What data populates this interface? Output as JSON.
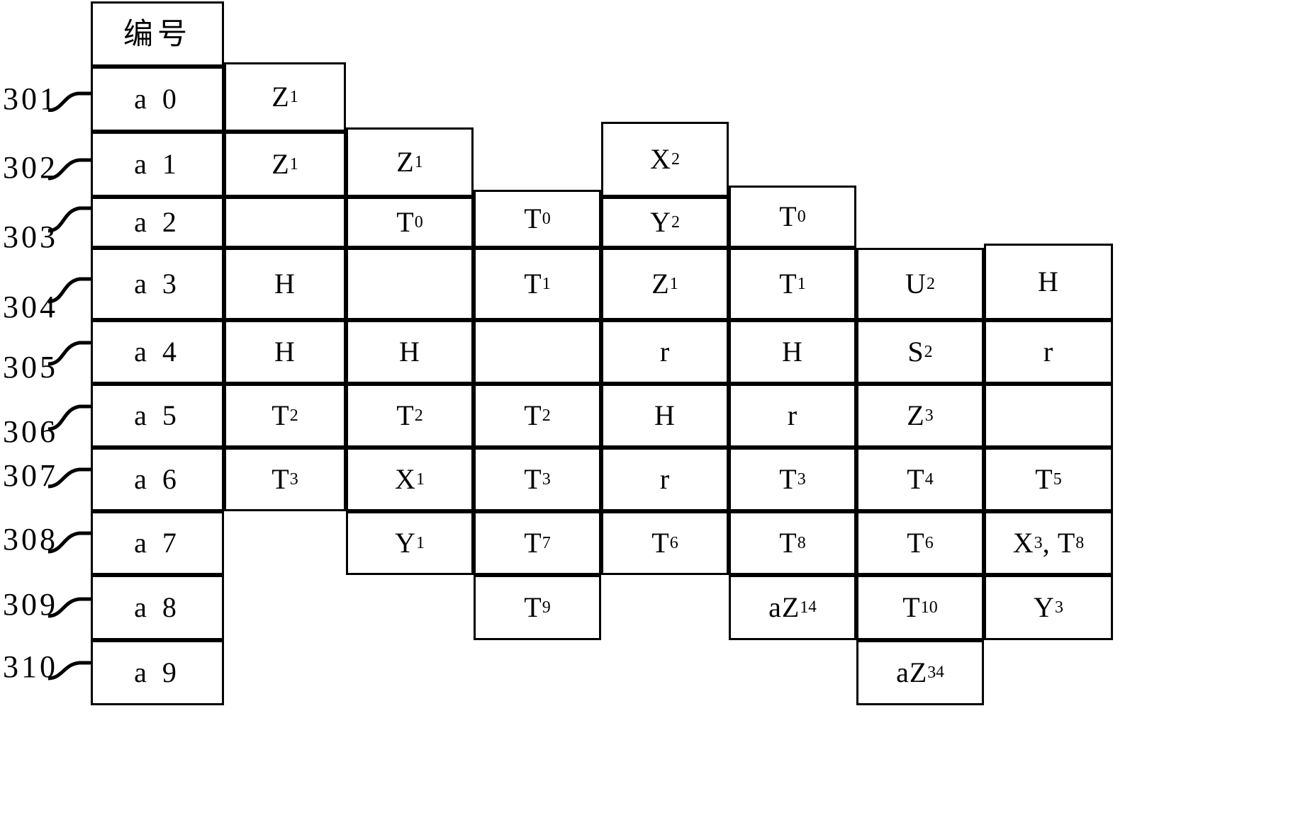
{
  "figure": {
    "kind": "patent-table-diagram",
    "header_label": "编号",
    "row_ref_labels": [
      "301",
      "302",
      "303",
      "304",
      "305",
      "306",
      "307",
      "308",
      "309",
      "310"
    ],
    "row_ids": [
      "a 0",
      "a 1",
      "a 2",
      "a 3",
      "a 4",
      "a 5",
      "a 6",
      "a 7",
      "a 8",
      "a 9"
    ],
    "column_count": 8
  },
  "chart_data": {
    "type": "table",
    "title": "编号",
    "row_labels": [
      "a 0",
      "a 1",
      "a 2",
      "a 3",
      "a 4",
      "a 5",
      "a 6",
      "a 7",
      "a 8",
      "a 9"
    ],
    "reference_numerals": [
      "301",
      "302",
      "303",
      "304",
      "305",
      "306",
      "307",
      "308",
      "309",
      "310"
    ],
    "columns": [
      "编号",
      "c2",
      "c3",
      "c4",
      "c5",
      "c6",
      "c7",
      "c8"
    ],
    "rows": [
      {
        "ref": "301",
        "id": "a 0",
        "cells": [
          "Z₁",
          null,
          null,
          null,
          null,
          null,
          null
        ]
      },
      {
        "ref": "302",
        "id": "a 1",
        "cells": [
          "Z₁",
          "Z₁",
          null,
          "X₂",
          null,
          null,
          null
        ]
      },
      {
        "ref": "303",
        "id": "a 2",
        "cells": [
          null,
          "T₀",
          "T₀",
          "Y₂",
          "T₀",
          null,
          null
        ]
      },
      {
        "ref": "304",
        "id": "a 3",
        "cells": [
          "H",
          null,
          "T₁",
          "Z₁",
          "T₁",
          "U₂",
          "H"
        ]
      },
      {
        "ref": "305",
        "id": "a 4",
        "cells": [
          "H",
          "H",
          null,
          "r",
          "H",
          "S₂",
          "r"
        ]
      },
      {
        "ref": "306",
        "id": "a 5",
        "cells": [
          "T₂",
          "T₂",
          "T₂",
          "H",
          "r",
          "Z₃",
          null
        ]
      },
      {
        "ref": "307",
        "id": "a 6",
        "cells": [
          "T₃",
          "X₁",
          "T₃",
          "r",
          "T₃",
          "T₄",
          "T₅"
        ]
      },
      {
        "ref": "308",
        "id": "a 7",
        "cells": [
          null,
          "Y₁",
          "T₇",
          "T₆",
          "T₈",
          "T₆",
          "X₃, T₈"
        ]
      },
      {
        "ref": "309",
        "id": "a 8",
        "cells": [
          null,
          null,
          "T₉",
          null,
          "aZ₁⁴",
          "T₁₀",
          "Y₃"
        ]
      },
      {
        "ref": "310",
        "id": "a 9",
        "cells": [
          null,
          null,
          null,
          null,
          null,
          "aZ₃⁴",
          null
        ]
      }
    ]
  },
  "cells": [
    {
      "name": "header-bianhao",
      "text": "编号",
      "html": "编号",
      "style": "hdr"
    },
    {
      "name": "cell-a0-id",
      "text": "a 0",
      "html": "a 0",
      "style": "lbl"
    },
    {
      "name": "cell-a0-c2",
      "text": "Z1",
      "html": "Z<sub>1</sub>"
    },
    {
      "name": "cell-a1-id",
      "text": "a 1",
      "html": "a 1",
      "style": "lbl"
    },
    {
      "name": "cell-a1-c2",
      "text": "Z1",
      "html": "Z<sub>1</sub>"
    },
    {
      "name": "cell-a1-c3",
      "text": "Z1",
      "html": "Z<sub>1</sub>"
    },
    {
      "name": "cell-a1-c4",
      "text": "",
      "html": ""
    },
    {
      "name": "cell-a1-c5",
      "text": "X2",
      "html": "X<sub>2</sub>"
    },
    {
      "name": "cell-a2-id",
      "text": "a 2",
      "html": "a 2",
      "style": "lbl"
    },
    {
      "name": "cell-a2-c2",
      "text": "",
      "html": ""
    },
    {
      "name": "cell-a2-c3",
      "text": "T0",
      "html": "T<sub>0</sub>"
    },
    {
      "name": "cell-a2-c4",
      "text": "T0",
      "html": "T<sub>0</sub>"
    },
    {
      "name": "cell-a2-c5",
      "text": "Y2",
      "html": "Y<sub>2</sub>"
    },
    {
      "name": "cell-a2-c6",
      "text": "T0",
      "html": "T<sub>0</sub>"
    },
    {
      "name": "cell-a3-id",
      "text": "a 3",
      "html": "a 3",
      "style": "lbl"
    },
    {
      "name": "cell-a3-c2",
      "text": "H",
      "html": "H"
    },
    {
      "name": "cell-a3-c3",
      "text": "",
      "html": ""
    },
    {
      "name": "cell-a3-c4",
      "text": "T1",
      "html": "T<sub>1</sub>"
    },
    {
      "name": "cell-a3-c5",
      "text": "Z1",
      "html": "Z<sub>1</sub>"
    },
    {
      "name": "cell-a3-c6",
      "text": "T1",
      "html": "T<sub>1</sub>"
    },
    {
      "name": "cell-a3-c7",
      "text": "U2",
      "html": "U<sub>2</sub>"
    },
    {
      "name": "cell-a3-c8",
      "text": "H",
      "html": "H"
    },
    {
      "name": "cell-a4-id",
      "text": "a 4",
      "html": "a 4",
      "style": "lbl"
    },
    {
      "name": "cell-a4-c2",
      "text": "H",
      "html": "H"
    },
    {
      "name": "cell-a4-c3",
      "text": "H",
      "html": "H"
    },
    {
      "name": "cell-a4-c4",
      "text": "",
      "html": ""
    },
    {
      "name": "cell-a4-c5",
      "text": "r",
      "html": "r"
    },
    {
      "name": "cell-a4-c6",
      "text": "H",
      "html": "H"
    },
    {
      "name": "cell-a4-c7",
      "text": "S2",
      "html": "S<sub>2</sub>"
    },
    {
      "name": "cell-a4-c8",
      "text": "r",
      "html": "r"
    },
    {
      "name": "cell-a5-id",
      "text": "a 5",
      "html": "a 5",
      "style": "lbl"
    },
    {
      "name": "cell-a5-c2",
      "text": "T2",
      "html": "T<sub>2</sub>"
    },
    {
      "name": "cell-a5-c3",
      "text": "T2",
      "html": "T<sub>2</sub>"
    },
    {
      "name": "cell-a5-c4",
      "text": "T2",
      "html": "T<sub>2</sub>"
    },
    {
      "name": "cell-a5-c5",
      "text": "H",
      "html": "H"
    },
    {
      "name": "cell-a5-c6",
      "text": "r",
      "html": "r"
    },
    {
      "name": "cell-a5-c7",
      "text": "Z3",
      "html": "Z<sub>3</sub>"
    },
    {
      "name": "cell-a5-c8",
      "text": "",
      "html": ""
    },
    {
      "name": "cell-a6-id",
      "text": "a 6",
      "html": "a 6",
      "style": "lbl"
    },
    {
      "name": "cell-a6-c2",
      "text": "T3",
      "html": "T<sub>3</sub>"
    },
    {
      "name": "cell-a6-c3",
      "text": "X1",
      "html": "X<sub>1</sub>"
    },
    {
      "name": "cell-a6-c4",
      "text": "T3",
      "html": "T<sub>3</sub>"
    },
    {
      "name": "cell-a6-c5",
      "text": "r",
      "html": "r"
    },
    {
      "name": "cell-a6-c6",
      "text": "T3",
      "html": "T<sub>3</sub>"
    },
    {
      "name": "cell-a6-c7",
      "text": "T4",
      "html": "T<sub>4</sub>"
    },
    {
      "name": "cell-a6-c8",
      "text": "T5",
      "html": "T<sub>5</sub>"
    },
    {
      "name": "cell-a7-id",
      "text": "a 7",
      "html": "a 7",
      "style": "lbl"
    },
    {
      "name": "cell-a7-c2",
      "text": "",
      "html": ""
    },
    {
      "name": "cell-a7-c3",
      "text": "Y1",
      "html": "Y<sub>1</sub>"
    },
    {
      "name": "cell-a7-c4",
      "text": "T7",
      "html": "T<sub>7</sub>"
    },
    {
      "name": "cell-a7-c5",
      "text": "T6",
      "html": "T<sub>6</sub>"
    },
    {
      "name": "cell-a7-c6",
      "text": "T8",
      "html": "T<sub>8</sub>"
    },
    {
      "name": "cell-a7-c7",
      "text": "T6",
      "html": "T<sub>6</sub>"
    },
    {
      "name": "cell-a7-c8",
      "text": "X3, T8",
      "html": "X<sub>3</sub>, T<sub>8</sub>"
    },
    {
      "name": "cell-a8-id",
      "text": "a 8",
      "html": "a 8",
      "style": "lbl"
    },
    {
      "name": "cell-a8-c4",
      "text": "T9",
      "html": "T<sub>9</sub>"
    },
    {
      "name": "cell-a8-c6",
      "text": "aZ1^4",
      "html": "aZ<sub>1</sub><sup>4</sup>"
    },
    {
      "name": "cell-a8-c7",
      "text": "T10",
      "html": "T<sub>10</sub>"
    },
    {
      "name": "cell-a8-c8",
      "text": "Y3",
      "html": "Y<sub>3</sub>"
    },
    {
      "name": "cell-a9-id",
      "text": "a 9",
      "html": "a 9",
      "style": "lbl"
    },
    {
      "name": "cell-a9-c7",
      "text": "aZ3^4",
      "html": "aZ<sub>3</sub><sup>4</sup>"
    }
  ]
}
